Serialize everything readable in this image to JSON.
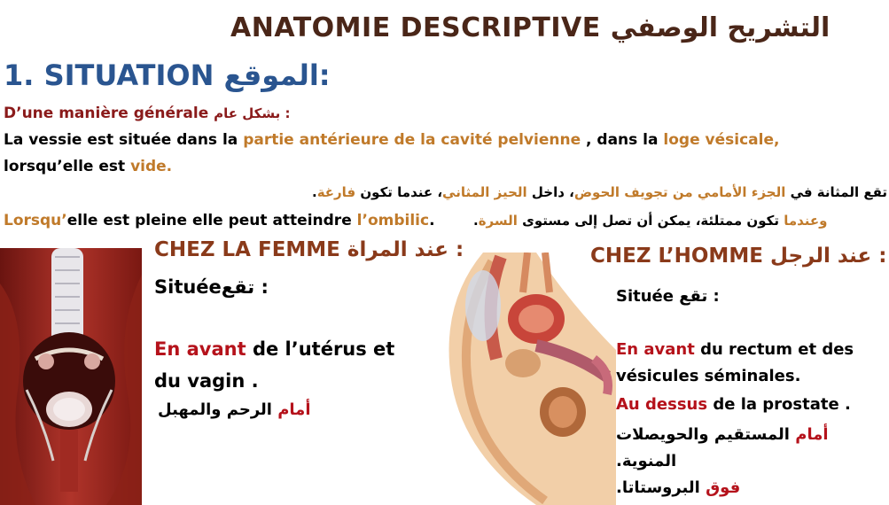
{
  "header": {
    "title_fr": "ANATOMIE DESCRIPTIVE",
    "title_ar": "التشريح الوصفي"
  },
  "section": {
    "heading_fr": "1. SITUATION",
    "heading_ar": "الموقع:"
  },
  "intro": {
    "general_fr": "D’une manière générale",
    "general_ar": "بشكل عام  :",
    "p1_a": "La vessie est située dans la ",
    "p1_b": "partie antérieure de la cavité pelvienne",
    "p1_c": " , dans la ",
    "p1_d": "loge vésicale,",
    "p2_a": "lorsqu’elle est ",
    "p2_b": "vide.",
    "ar1_a": "تقع المثانة في ",
    "ar1_b": "الجزء الأمامي من تجويف الحوض",
    "ar1_c": "، داخل ",
    "ar1_d": "الحيز المثاني",
    "ar1_e": "، عندما تكون ",
    "ar1_f": "فارغة",
    "ar1_g": ".",
    "p3_a": "Lorsqu’",
    "p3_b": "elle est pleine elle peut atteindre ",
    "p3_c": "l’ombilic",
    "p3_d": ".",
    "ar2_a": "وعندما",
    "ar2_b": " تكون ممتلئة، يمكن أن تصل إلى مستوى ",
    "ar2_c": "السرة",
    "ar2_d": "."
  },
  "femme": {
    "heading_fr": "CHEZ LA FEMME",
    "heading_ar": "عند المراة  :",
    "situee_fr": "Située",
    "situee_ar": "تقع  :",
    "line1_a": "En avant",
    "line1_b": " de l’utérus et",
    "line2": "du vagin .",
    "ar_a": "أمام",
    "ar_b": " الرحم والمهبل"
  },
  "homme": {
    "heading_fr": "CHEZ L’HOMME",
    "heading_ar": "عند الرجل :",
    "situee": "Située تقع :",
    "line1_a": "En avant",
    "line1_b": " du rectum et des",
    "line2": "vésicules séminales.",
    "line3_a": "Au dessus",
    "line3_b": " de la prostate .",
    "ar1_a": "أمام",
    "ar1_b": " المستقيم والحويصلات",
    "ar2": "المنوية.",
    "ar3_a": "فوق",
    "ar3_b": " البروستاتا."
  },
  "colors": {
    "title": "#4a2618",
    "heading": "#2a5590",
    "highlight_red": "#b5121b",
    "highlight_orange": "#c07a2a",
    "section_brown": "#8a3a1a"
  },
  "icons": [
    "female-pelvis-anatomy-image",
    "male-pelvis-anatomy-image"
  ]
}
